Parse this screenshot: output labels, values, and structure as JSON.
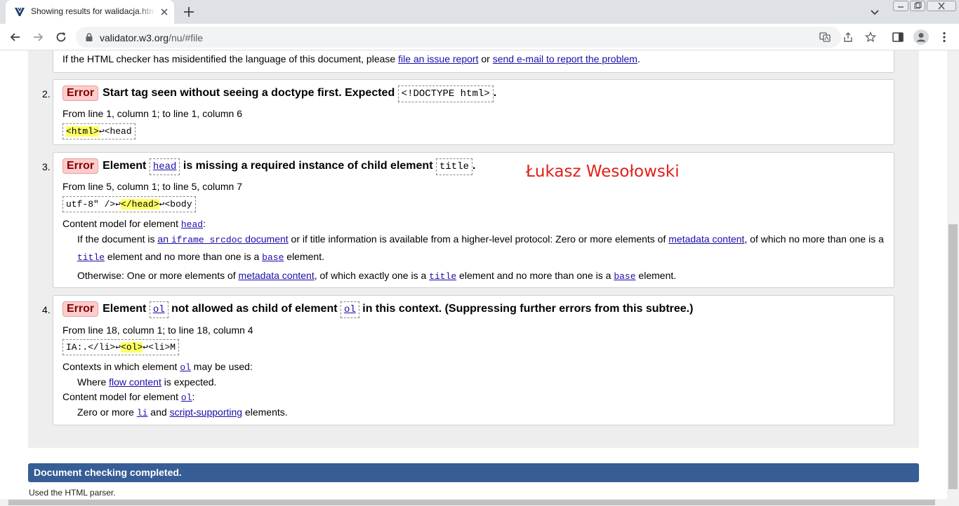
{
  "tab": {
    "title": "Showing results for walidacja.html",
    "favicon_icon": "w3c-validator-icon",
    "close_icon": "close-icon"
  },
  "address_bar": {
    "host": "validator.w3.org",
    "path": "/nu/#file"
  },
  "messages": {
    "lang_note": {
      "text_before": "If the HTML checker has misidentified the language of this document, please ",
      "link1": "file an issue report",
      "text_mid": " or ",
      "link2": "send e-mail to report the problem",
      "text_after": "."
    },
    "items": [
      {
        "number": "2.",
        "badge": "Error",
        "text_before": "Start tag seen without seeing a doctype first. Expected ",
        "code1": "<!DOCTYPE html>",
        "text_after": ".",
        "location": "From line 1, column 1; to line 1, column 6",
        "extract_highlight": "<html>",
        "extract_after": "↩<head"
      },
      {
        "number": "3.",
        "badge": "Error",
        "word1": "Element ",
        "code1": "head",
        "mid": " is missing a required instance of child element ",
        "code2": "title",
        "end": ".",
        "location": "From line 5, column 1; to line 5, column 7",
        "extract_before": "utf-8\" />↩",
        "extract_highlight": "</head>",
        "extract_after": "↩<body",
        "content_model_label": "Content model for element ",
        "content_model_el": "head",
        "colon": ":",
        "p1_a": "If the document is ",
        "p1_link_code": "iframe srcdoc",
        "p1_link_pre": "an ",
        "p1_link_post": " document",
        "p1_b": " or if title information is available from a higher-level protocol: Zero or more elements of ",
        "p1_link2": "metadata content",
        "p1_c": ", of which no more than one is a",
        "p1_code3": "title",
        "p1_d": " element and no more than one is a ",
        "p1_code4": "base",
        "p1_e": " element.",
        "p2_a": "Otherwise: One or more elements of ",
        "p2_link": "metadata content",
        "p2_b": ", of which exactly one is a ",
        "p2_code1": "title",
        "p2_c": " element and no more than one is a ",
        "p2_code2": "base",
        "p2_d": " element."
      },
      {
        "number": "4.",
        "badge": "Error",
        "word1": "Element ",
        "code1": "ol",
        "mid": " not allowed as child of element ",
        "code2": "ol",
        "end": " in this context. (Suppressing further errors from this subtree.)",
        "location": "From line 18, column 1; to line 18, column 4",
        "extract_before": "IA:.</li>↩",
        "extract_highlight": "<ol>",
        "extract_after": "↩<li>M",
        "contexts_label": "Contexts in which element ",
        "contexts_el": "ol",
        "contexts_after": " may be used:",
        "where_a": "Where ",
        "where_link": "flow content",
        "where_b": " is expected.",
        "cm_label": "Content model for element ",
        "cm_el": "ol",
        "cm_colon": ":",
        "cm_a": "Zero or more ",
        "cm_link1": "li",
        "cm_b": " and ",
        "cm_link2": "script-supporting",
        "cm_c": " elements."
      }
    ]
  },
  "signature": "Łukasz Wesołowski",
  "status": {
    "completed": "Document checking completed.",
    "parser": "Used the HTML parser."
  },
  "colors": {
    "error_badge_bg": "#ffcccc",
    "highlight": "#ffff66",
    "status_bar": "#365d95",
    "signature": "#e0201b"
  }
}
